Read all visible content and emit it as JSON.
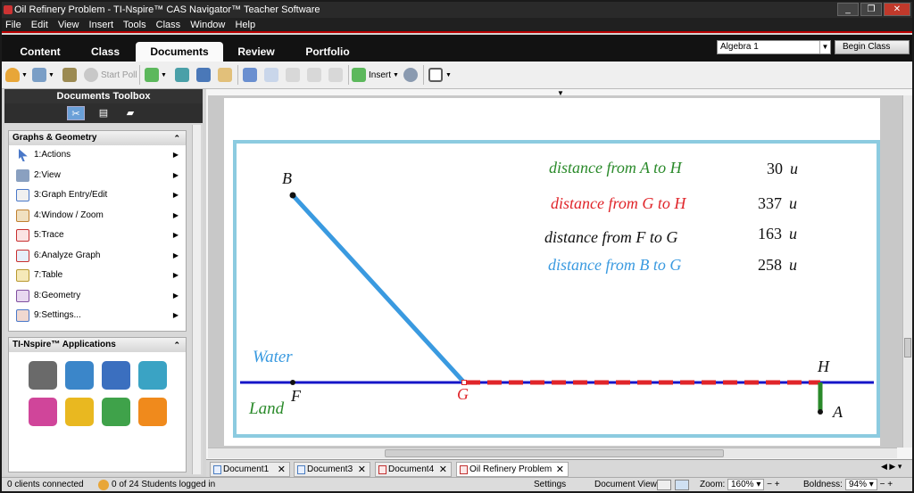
{
  "window": {
    "title": "Oil Refinery Problem - TI-Nspire™ CAS Navigator™ Teacher Software"
  },
  "menu": [
    "File",
    "Edit",
    "View",
    "Insert",
    "Tools",
    "Class",
    "Window",
    "Help"
  ],
  "main_tabs": [
    {
      "label": "Content",
      "active": false
    },
    {
      "label": "Class",
      "active": false
    },
    {
      "label": "Documents",
      "active": true
    },
    {
      "label": "Review",
      "active": false
    },
    {
      "label": "Portfolio",
      "active": false
    }
  ],
  "class_select": {
    "value": "Algebra 1"
  },
  "begin_class_label": "Begin Class",
  "toolbar": {
    "start_poll_label": "Start Poll",
    "insert_label": "Insert"
  },
  "toolbox": {
    "title": "Documents Toolbox",
    "graphs_section": {
      "title": "Graphs & Geometry",
      "items": [
        {
          "label": "1:Actions",
          "icon": "cursor-arrow-icon"
        },
        {
          "label": "2:View",
          "icon": "view-icon"
        },
        {
          "label": "3:Graph Entry/Edit",
          "icon": "graph-entry-icon"
        },
        {
          "label": "4:Window / Zoom",
          "icon": "window-zoom-icon"
        },
        {
          "label": "5:Trace",
          "icon": "trace-icon"
        },
        {
          "label": "6:Analyze Graph",
          "icon": "analyze-graph-icon"
        },
        {
          "label": "7:Table",
          "icon": "table-icon"
        },
        {
          "label": "8:Geometry",
          "icon": "geometry-icon"
        },
        {
          "label": "9:Settings...",
          "icon": "settings-icon"
        }
      ]
    },
    "apps_section": {
      "title": "TI-Nspire™ Applications",
      "apps": [
        {
          "name": "calculator-app-icon",
          "color": "#6a6a6a"
        },
        {
          "name": "graphs-app-icon",
          "color": "#3b86c9"
        },
        {
          "name": "geometry-app-icon",
          "color": "#3b6fbf"
        },
        {
          "name": "lists-spreadsheet-app-icon",
          "color": "#3aa3c4"
        },
        {
          "name": "data-statistics-app-icon",
          "color": "#d0459a"
        },
        {
          "name": "notes-app-icon",
          "color": "#e9b820"
        },
        {
          "name": "vernier-dataquest-app-icon",
          "color": "#3fa24a"
        },
        {
          "name": "question-app-icon",
          "color": "#f08a1c"
        }
      ]
    }
  },
  "canvas": {
    "measures": [
      {
        "label": "distance from A to H",
        "value": "30",
        "unit": "u",
        "color": "#2a8a2a"
      },
      {
        "label": "distance from G to H",
        "value": "337",
        "unit": "u",
        "color": "#e0252a"
      },
      {
        "label": "distance from F to G",
        "value": "163",
        "unit": "u",
        "color": "#000000"
      },
      {
        "label": "distance from B to G",
        "value": "258",
        "unit": "u",
        "color": "#3a9ae0"
      }
    ],
    "points": {
      "B": "B",
      "F": "F",
      "G": "G",
      "H": "H",
      "A": "A"
    },
    "water_label": "Water",
    "land_label": "Land",
    "colors": {
      "shore": "#1515c8",
      "pipe_water": "#3a9ae0",
      "pipe_land": "#e0252a",
      "pipe_short": "#2a8a2a",
      "frame": "#8ccbe0"
    }
  },
  "doc_tabs": [
    {
      "label": "Document1",
      "active": false
    },
    {
      "label": "Document3",
      "active": false
    },
    {
      "label": "Document4",
      "active": false
    },
    {
      "label": "Oil Refinery Problem",
      "active": true
    }
  ],
  "status": {
    "clients": "0 clients connected",
    "students": "0 of 24 Students logged in",
    "settings": "Settings",
    "doc_view": "Document View:",
    "zoom_label": "Zoom:",
    "zoom_value": "160%",
    "boldness_label": "Boldness:",
    "boldness_value": "94%"
  }
}
